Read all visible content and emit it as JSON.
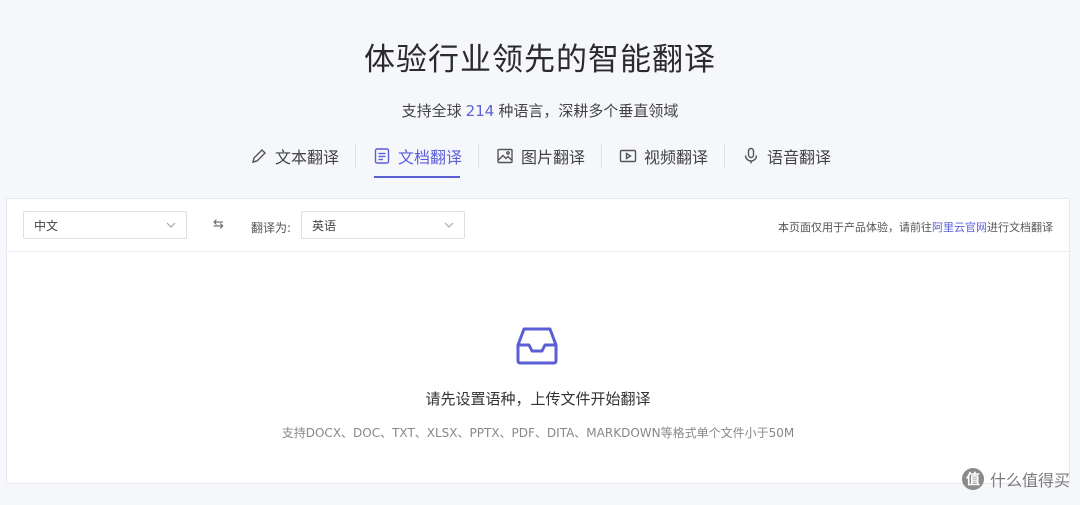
{
  "hero": {
    "title": "体验行业领先的智能翻译",
    "subtitle_prefix": "支持全球",
    "subtitle_number": "214",
    "subtitle_suffix": "种语言，深耕多个垂直领域"
  },
  "tabs": [
    {
      "label": "文本翻译",
      "icon": "pencil-icon",
      "active": false
    },
    {
      "label": "文档翻译",
      "icon": "document-icon",
      "active": true
    },
    {
      "label": "图片翻译",
      "icon": "image-icon",
      "active": false
    },
    {
      "label": "视频翻译",
      "icon": "video-icon",
      "active": false
    },
    {
      "label": "语音翻译",
      "icon": "microphone-icon",
      "active": false
    }
  ],
  "toolbar": {
    "source_language": "中文",
    "swap_symbol": "⇆",
    "target_label": "翻译为:",
    "target_language": "英语",
    "notice_prefix": "本页面仅用于产品体验，请前往",
    "notice_link": "阿里云官网",
    "notice_suffix": "进行文档翻译"
  },
  "empty_state": {
    "icon": "inbox-icon",
    "title": "请先设置语种，上传文件开始翻译",
    "hint": "支持DOCX、DOC、TXT、XLSX、PPTX、PDF、DITA、MARKDOWN等格式单个文件小于50M"
  },
  "watermark": {
    "badge": "值",
    "text": "什么值得买"
  },
  "colors": {
    "accent": "#5b5fd6",
    "background": "#f5f7fb",
    "panel": "#ffffff"
  }
}
